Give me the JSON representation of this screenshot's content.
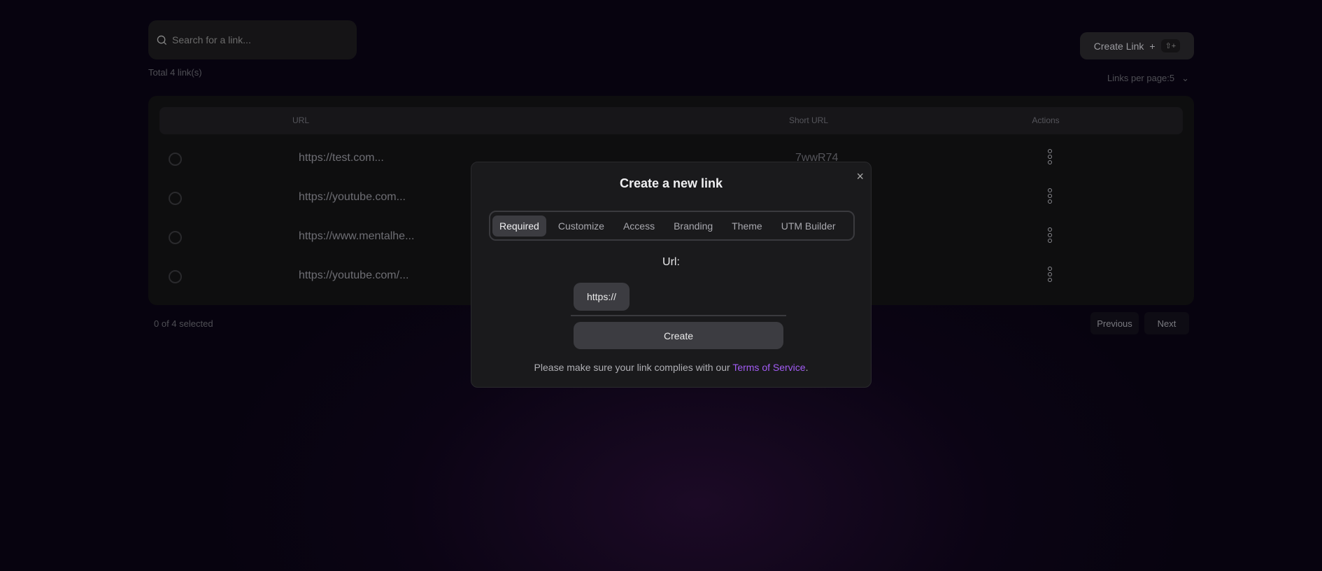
{
  "search": {
    "placeholder": "Search for a link..."
  },
  "total": "Total 4 link(s)",
  "create_link": {
    "label": "Create Link",
    "plus": "+",
    "shortcut": "⇧+"
  },
  "per_page": {
    "label": "Links per page:5",
    "chevron": "⌄"
  },
  "table": {
    "headers": {
      "url": "URL",
      "short_url": "Short URL",
      "actions": "Actions"
    },
    "rows": [
      {
        "url": "https://test.com...",
        "short": "7wwR74"
      },
      {
        "url": "https://youtube.com...",
        "short": ""
      },
      {
        "url": "https://www.mentalhe...",
        "short": ""
      },
      {
        "url": "https://youtube.com/...",
        "short": ""
      }
    ]
  },
  "selected": "0 of 4 selected",
  "pagination": {
    "previous": "Previous",
    "next": "Next"
  },
  "modal": {
    "title": "Create a new link",
    "close": "×",
    "tabs": [
      "Required",
      "Customize",
      "Access",
      "Branding",
      "Theme",
      "UTM Builder"
    ],
    "url_label": "Url:",
    "prefix": "https://",
    "url_value": "",
    "create": "Create",
    "notice_pre": "Please make sure your link complies with our ",
    "notice_link": "Terms of Service",
    "notice_post": "."
  },
  "colors": {
    "accent": "#a35cf5"
  }
}
